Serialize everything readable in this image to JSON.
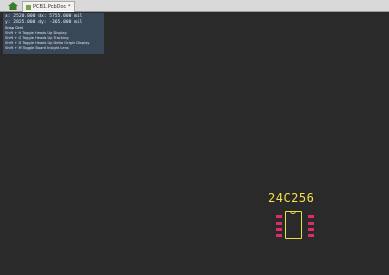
{
  "tabs": {
    "home_icon": "home-icon",
    "document": {
      "label": "PCB1.PcbDoc *",
      "icon": "pcb-document-icon"
    }
  },
  "hud": {
    "x_line": "x: 2520.000   dx: 5755.000 mil",
    "y_line": "y: 2825.000   dy: -365.000 mil",
    "hints_title": "Snap Grid",
    "hints": [
      "Shift + H   Toggle Heads Up Display",
      "Shift + G   Toggle Heads Up Tracking",
      "Shift + D   Toggle Heads Up Delta Origin Display",
      "Shift + M   Toggle Board Insight Lens"
    ]
  },
  "component": {
    "designator": "24C256",
    "colors": {
      "silkscreen": "#f0dd3c",
      "pads": "#e02a6a",
      "background": "#2a2a2a",
      "hud": "#3c4e60"
    }
  }
}
